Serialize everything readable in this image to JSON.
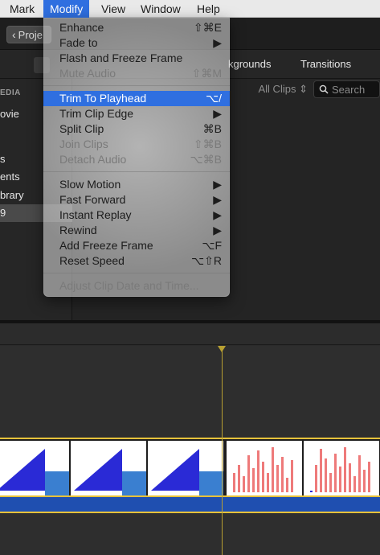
{
  "menubar": {
    "items": [
      {
        "label": "Mark"
      },
      {
        "label": "Modify",
        "active": true
      },
      {
        "label": "View"
      },
      {
        "label": "Window"
      },
      {
        "label": "Help"
      }
    ]
  },
  "toolbar": {
    "back_label": "Proje"
  },
  "tabs": {
    "backgrounds": "kgrounds",
    "transitions": "Transitions"
  },
  "browser": {
    "filter_label": "All Clips",
    "search_placeholder": "Search"
  },
  "sidebar": {
    "heading": "EDIA",
    "items": [
      {
        "label": "ovie"
      },
      {
        "label": "s"
      },
      {
        "label": "ents"
      },
      {
        "label": "brary"
      },
      {
        "label": "9"
      }
    ]
  },
  "modify_menu": {
    "groups": [
      [
        {
          "label": "Enhance",
          "shortcut": "⇧⌘E",
          "enabled": true
        },
        {
          "label": "Fade to",
          "shortcut": "▶",
          "enabled": true
        },
        {
          "label": "Flash and Freeze Frame",
          "shortcut": "",
          "enabled": true
        },
        {
          "label": "Mute Audio",
          "shortcut": "⇧⌘M",
          "enabled": false
        }
      ],
      [
        {
          "label": "Trim To Playhead",
          "shortcut": "⌥/",
          "enabled": true,
          "highlighted": true
        },
        {
          "label": "Trim Clip Edge",
          "shortcut": "▶",
          "enabled": true
        },
        {
          "label": "Split Clip",
          "shortcut": "⌘B",
          "enabled": true
        },
        {
          "label": "Join Clips",
          "shortcut": "⇧⌘B",
          "enabled": false
        },
        {
          "label": "Detach Audio",
          "shortcut": "⌥⌘B",
          "enabled": false
        }
      ],
      [
        {
          "label": "Slow Motion",
          "shortcut": "▶",
          "enabled": true
        },
        {
          "label": "Fast Forward",
          "shortcut": "▶",
          "enabled": true
        },
        {
          "label": "Instant Replay",
          "shortcut": "▶",
          "enabled": true
        },
        {
          "label": "Rewind",
          "shortcut": "▶",
          "enabled": true
        },
        {
          "label": "Add Freeze Frame",
          "shortcut": "⌥F",
          "enabled": true
        },
        {
          "label": "Reset Speed",
          "shortcut": "⌥⇧R",
          "enabled": true
        }
      ],
      [
        {
          "label": "Adjust Clip Date and Time...",
          "shortcut": "",
          "enabled": false
        }
      ]
    ]
  },
  "timeline": {
    "clips": [
      {
        "kind": "blue-bars"
      },
      {
        "kind": "blue-bars"
      },
      {
        "kind": "blue-bars"
      },
      {
        "kind": "red-bars"
      },
      {
        "kind": "red-bars"
      }
    ]
  },
  "colors": {
    "accent": "#2f6fe0",
    "clip_border": "#e6c23a",
    "audio_track": "#1f4fb0",
    "playhead": "#b8a032"
  }
}
